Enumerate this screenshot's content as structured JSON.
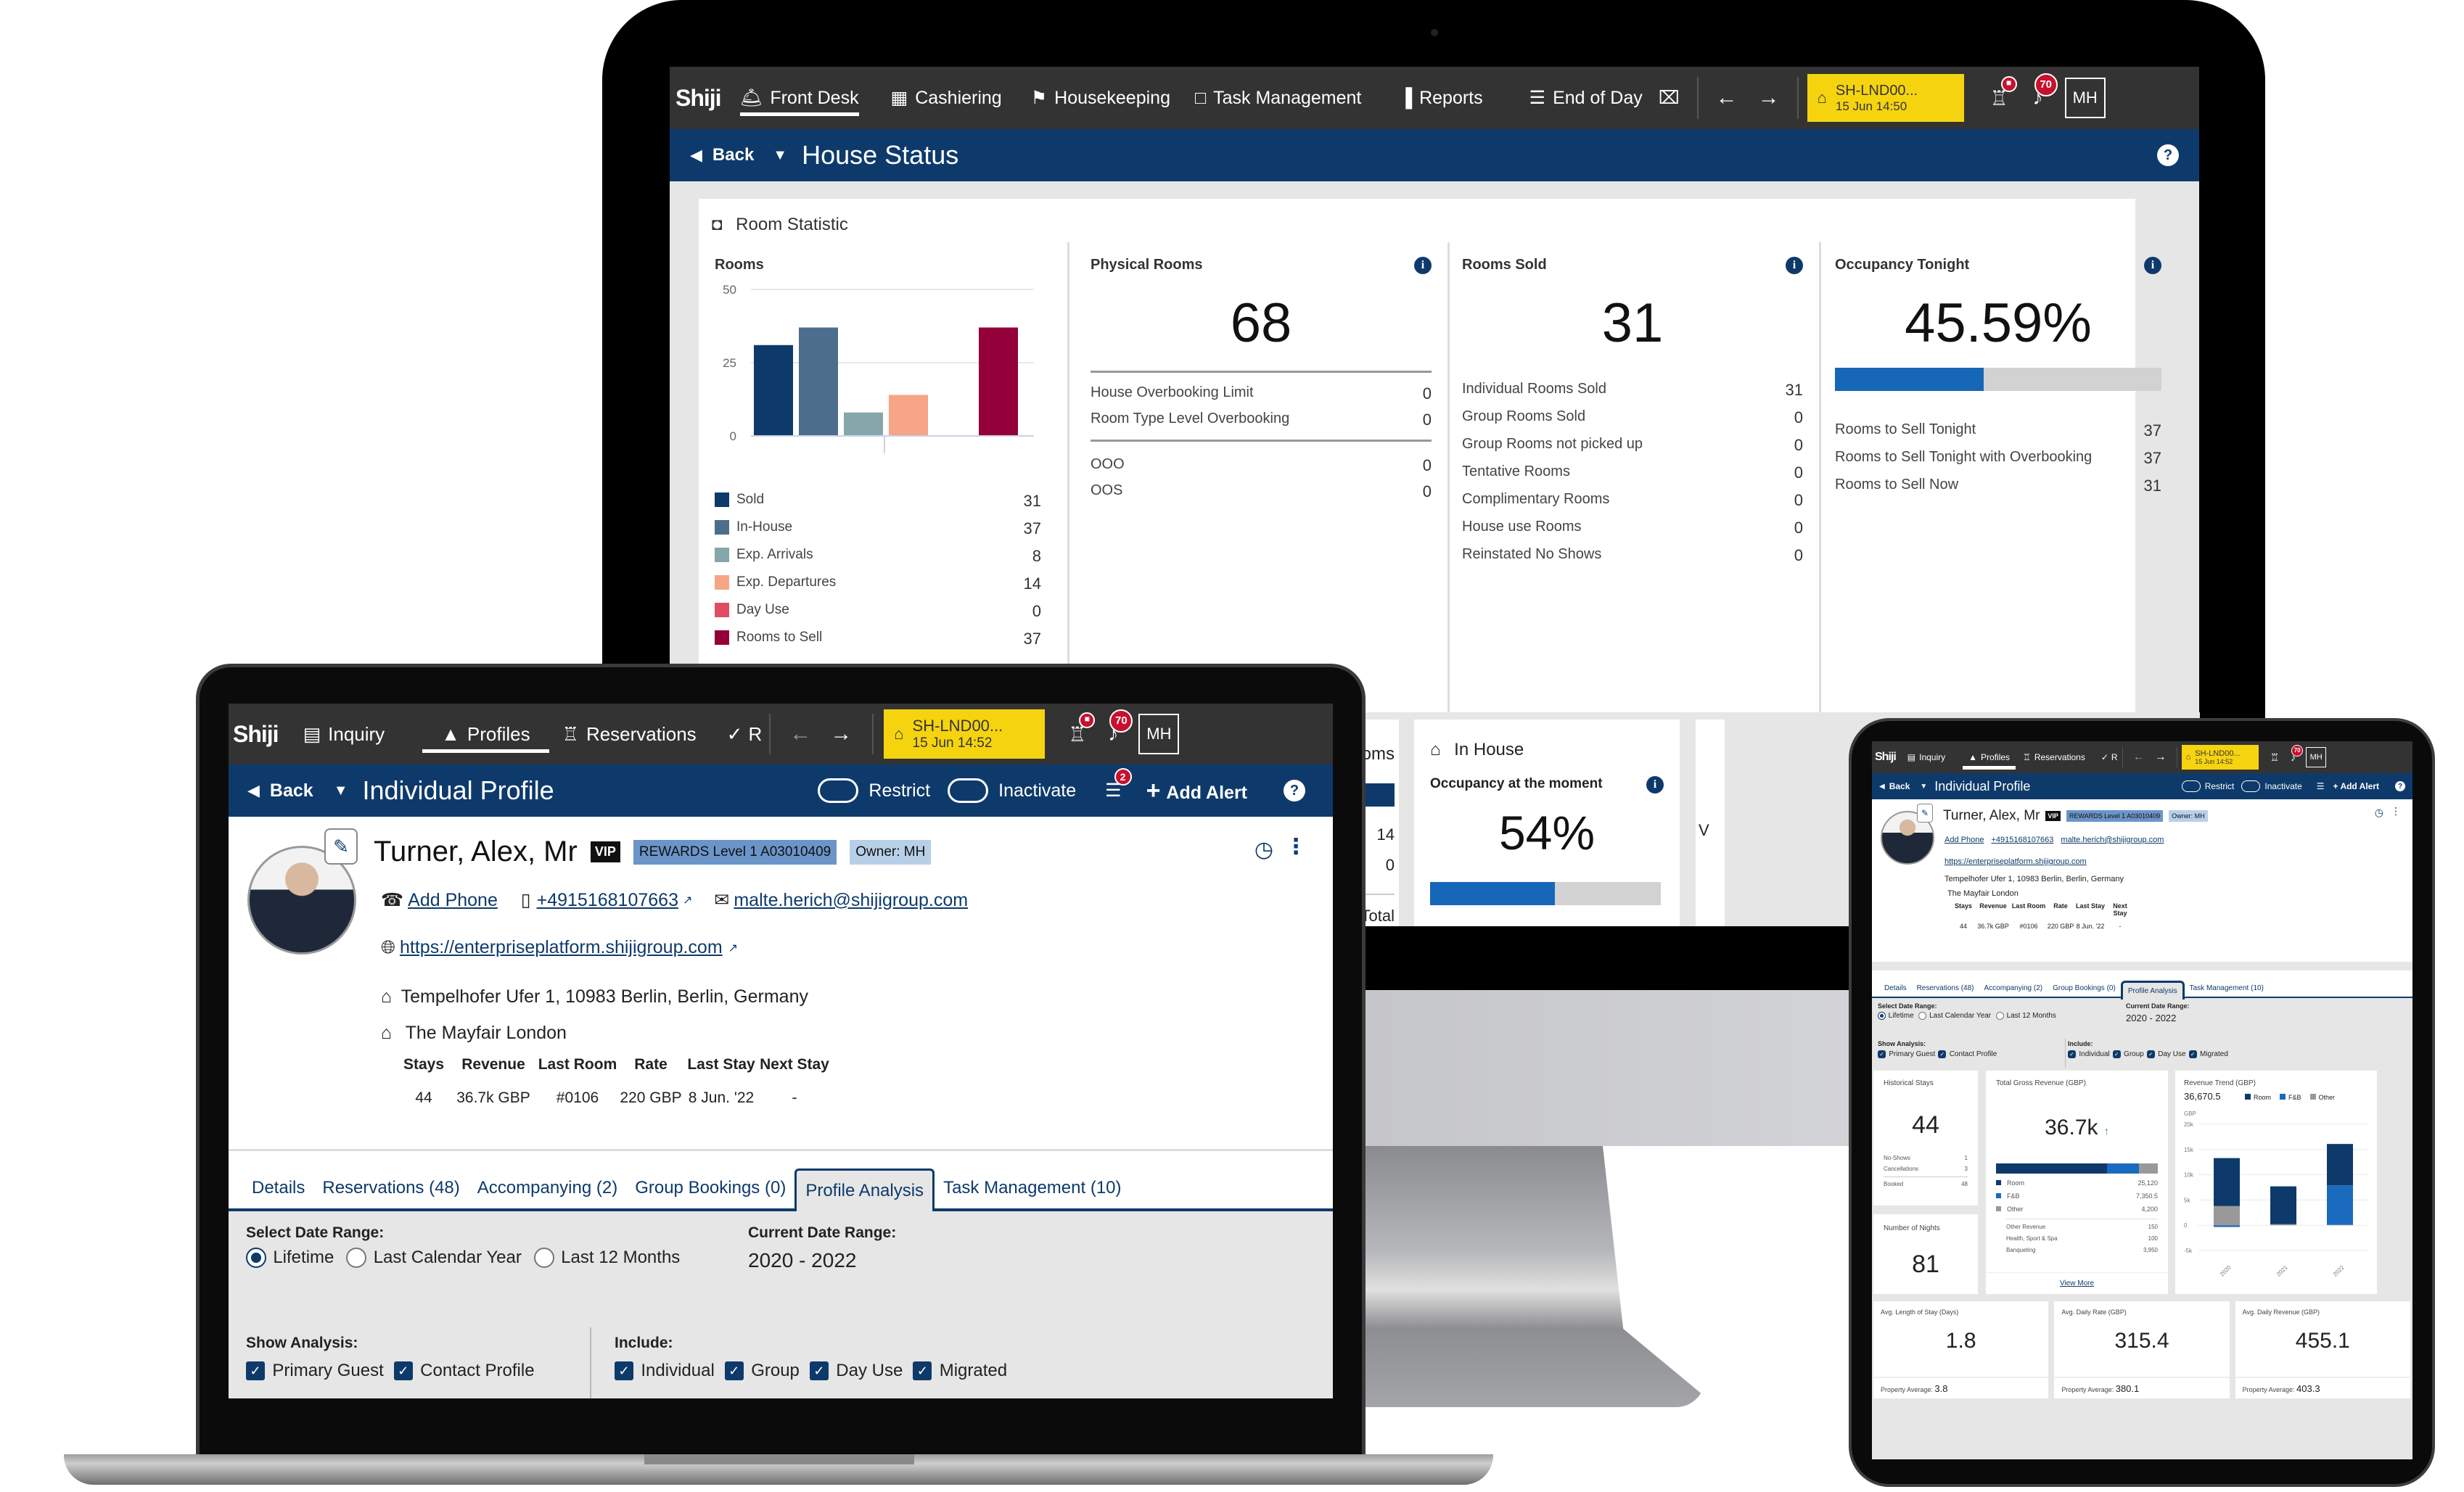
{
  "brand": {
    "logo": "Shiji",
    "primary": "#0e3a6b",
    "topbar": "#333333",
    "property_yellow": "#f5d40f",
    "alert_red": "#c8102e"
  },
  "monitor": {
    "nav": [
      {
        "label": "Front Desk",
        "icon": "bell-icon",
        "active": true
      },
      {
        "label": "Cashiering",
        "icon": "calculator-icon"
      },
      {
        "label": "Housekeeping",
        "icon": "broom-icon"
      },
      {
        "label": "Task Management",
        "icon": "clipboard-icon"
      },
      {
        "label": "Reports",
        "icon": "bar-chart-icon"
      },
      {
        "label": "End of Day",
        "icon": "document-icon"
      }
    ],
    "property": {
      "code": "SH-LND00...",
      "datetime": "15 Jun 14:50"
    },
    "alerts_count": "70",
    "user_initials": "MH",
    "back_label": "Back",
    "page_title": "House Status",
    "help": "?",
    "section_title": "Room Statistic",
    "rooms": {
      "title": "Rooms",
      "legend": [
        {
          "label": "Sold",
          "value": "31",
          "color": "#0e3a6b"
        },
        {
          "label": "In-House",
          "value": "37",
          "color": "#4d6d8c"
        },
        {
          "label": "Exp. Arrivals",
          "value": "8",
          "color": "#85a6ab"
        },
        {
          "label": "Exp. Departures",
          "value": "14",
          "color": "#f7a487"
        },
        {
          "label": "Day Use",
          "value": "0",
          "color": "#dd4e62"
        },
        {
          "label": "Rooms to Sell",
          "value": "37",
          "color": "#93003a"
        }
      ]
    },
    "physical_rooms": {
      "title": "Physical Rooms",
      "value": "68",
      "rows": [
        {
          "label": "House Overbooking Limit",
          "value": "0"
        },
        {
          "label": "Room Type Level Overbooking",
          "value": "0"
        }
      ],
      "rows2": [
        {
          "label": "OOO",
          "value": "0"
        },
        {
          "label": "OOS",
          "value": "0"
        }
      ]
    },
    "rooms_sold": {
      "title": "Rooms Sold",
      "value": "31",
      "rows": [
        {
          "label": "Individual Rooms Sold",
          "value": "31"
        },
        {
          "label": "Group Rooms Sold",
          "value": "0"
        },
        {
          "label": "Group Rooms not picked up",
          "value": "0"
        },
        {
          "label": "Tentative Rooms",
          "value": "0"
        },
        {
          "label": "Complimentary Rooms",
          "value": "0"
        },
        {
          "label": "House use Rooms",
          "value": "0"
        },
        {
          "label": "Reinstated No Shows",
          "value": "0"
        }
      ]
    },
    "occupancy_tonight": {
      "title": "Occupancy Tonight",
      "value": "45.59%",
      "fraction": 0.4559,
      "rows": [
        {
          "label": "Rooms to Sell Tonight",
          "value": "37"
        },
        {
          "label": "Rooms to Sell Tonight with Overbooking",
          "value": "37"
        },
        {
          "label": "Rooms to Sell Now",
          "value": "31"
        }
      ]
    },
    "partial_card": {
      "label_fragment": "oms",
      "v1": "14",
      "v2": "0",
      "total_label": "Total"
    },
    "in_house": {
      "title": "In House",
      "subtitle": "Occupancy at the moment",
      "value": "54%",
      "fraction": 0.54
    },
    "third_card_fragment": "V"
  },
  "chart_data": [
    {
      "type": "bar",
      "title": "Rooms",
      "categories": [
        "Sold",
        "In-House",
        "Exp. Arrivals",
        "Exp. Departures",
        "Day Use",
        "Rooms to Sell"
      ],
      "values": [
        31,
        37,
        8,
        14,
        0,
        37
      ],
      "colors": [
        "#0e3a6b",
        "#4d6d8c",
        "#85a6ab",
        "#f7a487",
        "#dd4e62",
        "#93003a"
      ],
      "yticks": [
        "0",
        "25",
        "50"
      ],
      "ylim": [
        0,
        50
      ],
      "grid": true
    },
    {
      "type": "bar",
      "stacked": true,
      "title": "Revenue Trend (GBP)",
      "total_label": "36,670.5",
      "ylabel": "GBP",
      "categories": [
        "2020",
        "2021",
        "2022"
      ],
      "series": [
        {
          "name": "Room",
          "color": "#0e3a6b",
          "values": [
            9500,
            7500,
            8200
          ]
        },
        {
          "name": "F&B",
          "color": "#1a6bbd",
          "values": [
            -350,
            0,
            7800
          ]
        },
        {
          "name": "Other",
          "color": "#999999",
          "values": [
            3800,
            200,
            100
          ]
        }
      ],
      "yticks": [
        "-5k",
        "0",
        "5k",
        "10k",
        "15k",
        "20k"
      ],
      "ylim": [
        -5000,
        20000
      ],
      "legend": "top-right",
      "grid": true
    }
  ],
  "profile": {
    "nav": [
      {
        "label": "Inquiry",
        "icon": "calendar-icon"
      },
      {
        "label": "Profiles",
        "icon": "person-icon",
        "active": true
      },
      {
        "label": "Reservations",
        "icon": "reception-icon"
      },
      {
        "label": "R",
        "icon": "checklist-icon"
      }
    ],
    "property": {
      "code": "SH-LND00...",
      "datetime": "15 Jun 14:52"
    },
    "alerts_count": "70",
    "user_initials": "MH",
    "back_label": "Back",
    "page_title": "Individual Profile",
    "restrict_label": "Restrict",
    "inactivate_label": "Inactivate",
    "notes_count": "2",
    "add_alert_label": "Add Alert",
    "help": "?",
    "name": "Turner, Alex, Mr",
    "vip": "VIP",
    "rewards": "REWARDS Level 1 A03010409",
    "owner": "Owner: MH",
    "add_phone": "Add Phone",
    "mobile": "+4915168107663",
    "email": "malte.herich@shijigroup.com",
    "website": "https://enterpriseplatform.shijigroup.com",
    "address": "Tempelhofer Ufer 1, 10983 Berlin, Berlin, Germany",
    "hotel": "The Mayfair London",
    "stats_headers": [
      "Stays",
      "Revenue",
      "Last Room",
      "Rate",
      "Last Stay",
      "Next Stay"
    ],
    "stats_values": [
      "44",
      "36.7k GBP",
      "#0106",
      "220 GBP",
      "8 Jun. '22",
      "-"
    ],
    "tabs": [
      {
        "label": "Details"
      },
      {
        "label": "Reservations (48)"
      },
      {
        "label": "Accompanying (2)"
      },
      {
        "label": "Group Bookings (0)"
      },
      {
        "label": "Profile Analysis",
        "active": true
      },
      {
        "label": "Task Management (10)"
      }
    ],
    "date_range_label": "Select Date Range:",
    "date_options": [
      {
        "label": "Lifetime",
        "selected": true
      },
      {
        "label": "Last Calendar Year",
        "selected": false
      },
      {
        "label": "Last 12 Months",
        "selected": false
      }
    ],
    "current_range_label": "Current Date Range:",
    "current_range": "2020 - 2022",
    "show_analysis_label": "Show Analysis:",
    "show_analysis": [
      {
        "label": "Primary Guest",
        "checked": true
      },
      {
        "label": "Contact Profile",
        "checked": true
      }
    ],
    "include_label": "Include:",
    "include": [
      {
        "label": "Individual",
        "checked": true
      },
      {
        "label": "Group",
        "checked": true
      },
      {
        "label": "Day Use",
        "checked": true
      },
      {
        "label": "Migrated",
        "checked": true
      }
    ]
  },
  "analysis": {
    "historical_stays": {
      "title": "Historical Stays",
      "value": "44",
      "rows": [
        {
          "label": "No-Shows",
          "value": "1"
        },
        {
          "label": "Cancellations",
          "value": "3"
        }
      ],
      "booked": {
        "label": "Booked",
        "value": "48"
      }
    },
    "nights": {
      "title": "Number of Nights",
      "value": "81"
    },
    "gross_revenue": {
      "title": "Total Gross Revenue (GBP)",
      "value": "36.7k",
      "trend": "up",
      "breakdown": [
        {
          "label": "Room",
          "value": "25,120",
          "color": "#0e3a6b"
        },
        {
          "label": "F&B",
          "value": "7,350.5",
          "color": "#1a6bbd"
        },
        {
          "label": "Other",
          "value": "4,200",
          "color": "#999999"
        }
      ],
      "other_rows": [
        {
          "label": "Other Revenue",
          "value": "150"
        },
        {
          "label": "Health, Sport & Spa",
          "value": "100"
        },
        {
          "label": "Banqueting",
          "value": "3,950"
        }
      ],
      "view_more": "View More"
    },
    "kpis": [
      {
        "title": "Avg. Length of Stay (Days)",
        "value": "1.8",
        "avg_label": "Property Average:",
        "avg": "3.8"
      },
      {
        "title": "Avg. Daily Rate (GBP)",
        "value": "315.4",
        "avg_label": "Property Average:",
        "avg": "380.1"
      },
      {
        "title": "Avg. Daily Revenue (GBP)",
        "value": "455.1",
        "avg_label": "Property Average:",
        "avg": "403.3"
      }
    ]
  }
}
